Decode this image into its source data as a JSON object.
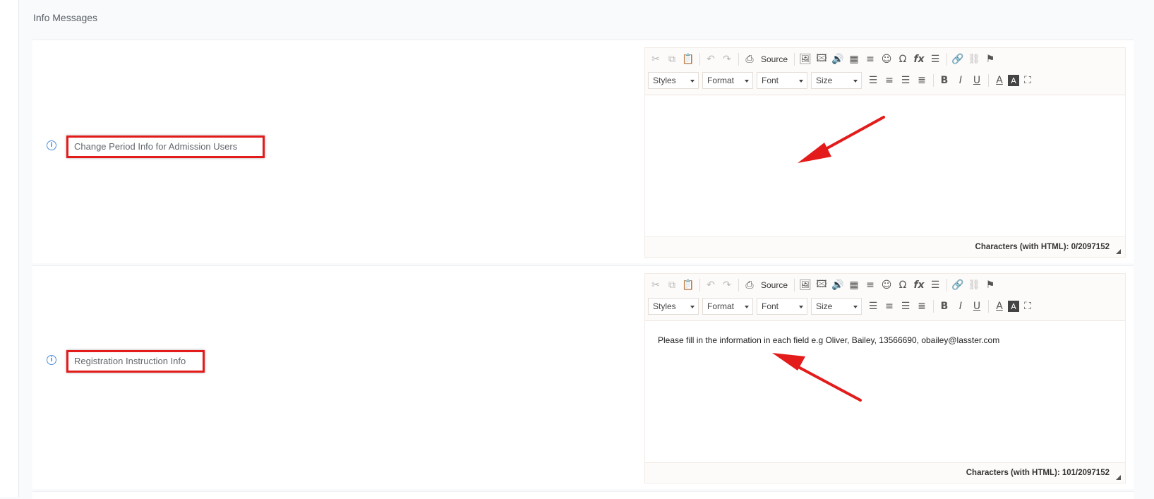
{
  "section": {
    "title": "Info Messages"
  },
  "toolbar": {
    "source_label": "Source",
    "styles_label": "Styles",
    "format_label": "Format",
    "font_label": "Font",
    "size_label": "Size",
    "bold_glyph": "B",
    "italic_glyph": "I",
    "underline_glyph": "U",
    "text_color_glyph": "A",
    "bg_color_glyph": "A",
    "omega_glyph": "Ω",
    "fx_glyph": "fx"
  },
  "fields": [
    {
      "label": "Change Period Info for Admission Users",
      "content": "",
      "char_count": "Characters (with HTML): 0/2097152"
    },
    {
      "label": "Registration Instruction Info",
      "content": "Please fill in the information in each field e.g Oliver, Bailey, 13566690, obailey@lasster.com",
      "char_count": "Characters (with HTML): 101/2097152"
    }
  ],
  "colors": {
    "highlight_border": "#e31b1b",
    "info_icon": "#4a8fd8"
  }
}
